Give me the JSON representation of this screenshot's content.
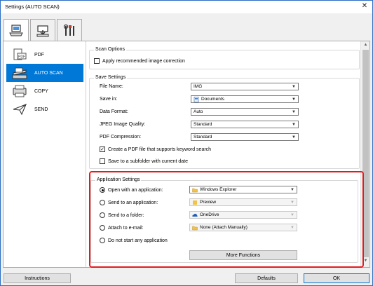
{
  "window": {
    "title": "Settings (AUTO SCAN)",
    "close_glyph": "✕"
  },
  "tabs": [
    {
      "name": "scan-from-computer-tab",
      "icon": "computer-scan-icon"
    },
    {
      "name": "scan-from-panel-tab",
      "icon": "panel-scan-icon"
    },
    {
      "name": "general-settings-tab",
      "icon": "tools-icon"
    }
  ],
  "sidebar": {
    "items": [
      {
        "label": "PDF",
        "icon": "pdf-document-icon"
      },
      {
        "label": "AUTO SCAN",
        "icon": "scanner-icon"
      },
      {
        "label": "COPY",
        "icon": "copy-icon"
      },
      {
        "label": "SEND",
        "icon": "send-plane-icon"
      }
    ]
  },
  "scan_options": {
    "legend": "Scan Options",
    "apply_correction": "Apply recommended image correction"
  },
  "save_settings": {
    "legend": "Save Settings",
    "file_name_label": "File Name:",
    "file_name_value": "IMG",
    "save_in_label": "Save in:",
    "save_in_value": "Documents",
    "data_format_label": "Data Format:",
    "data_format_value": "Auto",
    "jpeg_quality_label": "JPEG Image Quality:",
    "jpeg_quality_value": "Standard",
    "pdf_compression_label": "PDF Compression:",
    "pdf_compression_value": "Standard",
    "keyword_pdf": "Create a PDF file that supports keyword search",
    "keyword_pdf_checked": true,
    "subfolder": "Save to a subfolder with current date",
    "subfolder_checked": false
  },
  "application_settings": {
    "legend": "Application Settings",
    "open_app_label": "Open with an application:",
    "open_app_value": "Windows Explorer",
    "send_app_label": "Send to an application:",
    "send_app_value": "Preview",
    "send_folder_label": "Send to a folder:",
    "send_folder_value": "OneDrive",
    "attach_email_label": "Attach to e-mail:",
    "attach_email_value": "None (Attach Manually)",
    "no_app_label": "Do not start any application",
    "more_functions": "More Functions",
    "selected_option": "open_app"
  },
  "footer": {
    "instructions": "Instructions",
    "defaults": "Defaults",
    "ok": "OK"
  },
  "colors": {
    "highlight": "#e11b22",
    "selection": "#0078d7"
  }
}
